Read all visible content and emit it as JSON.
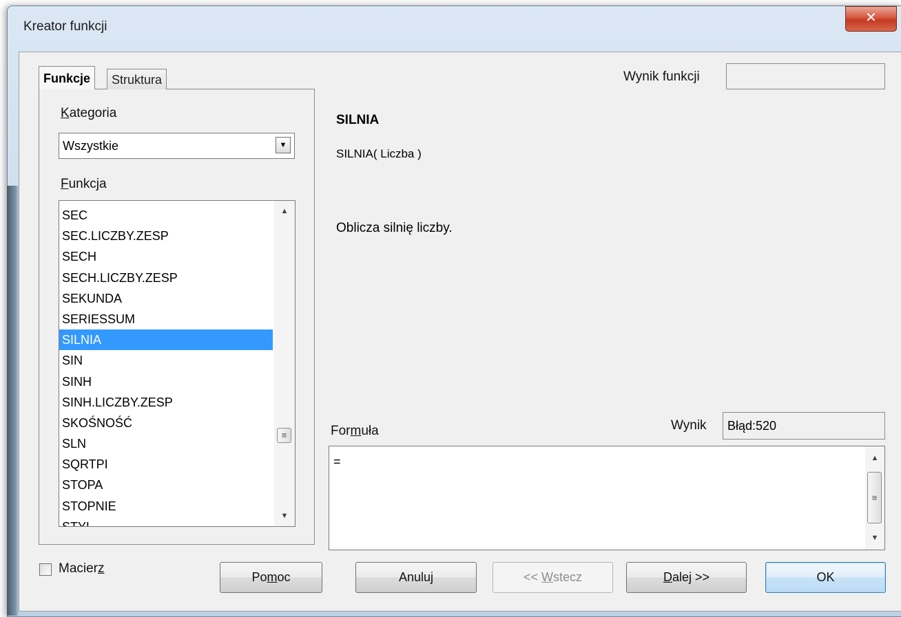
{
  "window": {
    "title": "Kreator funkcji",
    "close_glyph": "✕"
  },
  "tabs": [
    {
      "label": "Funkcje",
      "active": true
    },
    {
      "label": "Struktura",
      "active": false
    }
  ],
  "category": {
    "label": "Kategoria",
    "selected": "Wszystkie"
  },
  "function_list": {
    "label": "Funkcja",
    "items": [
      "SEC",
      "SEC.LICZBY.ZESP",
      "SECH",
      "SECH.LICZBY.ZESP",
      "SEKUNDA",
      "SERIESSUM",
      "SILNIA",
      "SIN",
      "SINH",
      "SINH.LICZBY.ZESP",
      "SKOŚNOŚĆ",
      "SLN",
      "SQRTPI",
      "STOPA",
      "STOPNIE",
      "STYL"
    ],
    "selected": "SILNIA"
  },
  "result_top": {
    "label": "Wynik funkcji",
    "value": ""
  },
  "function_info": {
    "name": "SILNIA",
    "syntax": "SILNIA( Liczba )",
    "description": "Oblicza silnię liczby."
  },
  "result": {
    "label": "Wynik",
    "value": "Błąd:520"
  },
  "formula": {
    "label": "Formuła",
    "value": "="
  },
  "array_checkbox": {
    "label": "Macierz",
    "checked": false
  },
  "buttons": {
    "help": "Pomoc",
    "cancel": "Anuluj",
    "back": "<< Wstecz",
    "next": "Dalej >>",
    "ok": "OK"
  },
  "icons": {
    "dropdown": "chevron-down-icon",
    "scroll_up": "arrow-up-icon",
    "scroll_down": "arrow-down-icon",
    "grip": "scroll-grip-icon"
  },
  "colors": {
    "selection": "#3399ff",
    "close_button": "#c8462e",
    "frame": "#c6d7ea"
  }
}
